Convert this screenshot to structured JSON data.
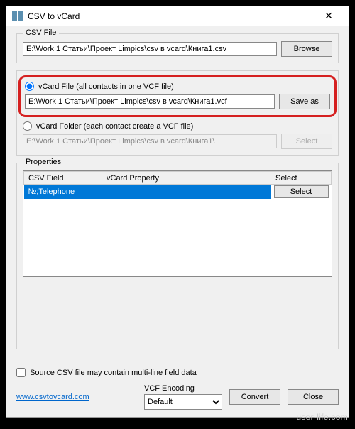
{
  "window": {
    "title": "CSV to vCard"
  },
  "csv_group": {
    "label": "CSV File",
    "path": "E:\\Work 1 Статьи\\Проект Limpics\\csv в vcard\\Книга1.csv",
    "browse": "Browse"
  },
  "output": {
    "option_file": {
      "label": "vCard File (all contacts in one VCF file)",
      "path": "E:\\Work 1 Статьи\\Проект Limpics\\csv в vcard\\Книга1.vcf",
      "button": "Save as",
      "selected": true
    },
    "option_folder": {
      "label": "vCard Folder (each contact create a VCF file)",
      "path": "E:\\Work 1 Статьи\\Проект Limpics\\csv в vcard\\Книга1\\",
      "button": "Select",
      "selected": false
    }
  },
  "properties": {
    "label": "Properties",
    "headers": {
      "csv": "CSV Field",
      "vcard": "vCard Property",
      "select": "Select"
    },
    "rows": [
      {
        "csv": "№;Telephone",
        "vcard": "",
        "button": "Select"
      }
    ]
  },
  "footer": {
    "multiline_label": "Source CSV file may contain multi-line field data",
    "link_text": "www.csvtovcard.com",
    "encoding_label": "VCF Encoding",
    "encoding_value": "Default",
    "convert": "Convert",
    "close": "Close"
  },
  "watermark": "user-life.com"
}
